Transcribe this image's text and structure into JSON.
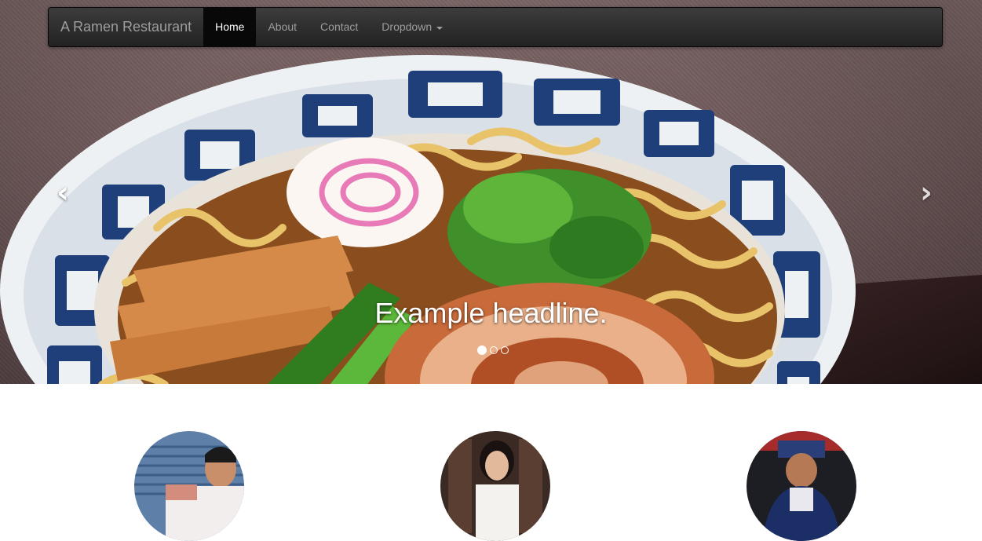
{
  "navbar": {
    "brand": "A Ramen Restaurant",
    "items": [
      {
        "label": "Home",
        "active": true
      },
      {
        "label": "About",
        "active": false
      },
      {
        "label": "Contact",
        "active": false
      },
      {
        "label": "Dropdown",
        "active": false,
        "has_caret": true
      }
    ]
  },
  "carousel": {
    "caption": "Example headline.",
    "slide_count": 3,
    "active_slide": 1,
    "prev_icon": "chevron-left-icon",
    "next_icon": "chevron-right-icon"
  },
  "marketing": {
    "avatars": [
      "avatar-man-chef",
      "avatar-woman",
      "avatar-cook"
    ]
  },
  "colors": {
    "navbar_bg": "#222222",
    "navbar_active_bg": "#080808",
    "navbar_text": "#9d9d9d",
    "active_text": "#ffffff"
  }
}
